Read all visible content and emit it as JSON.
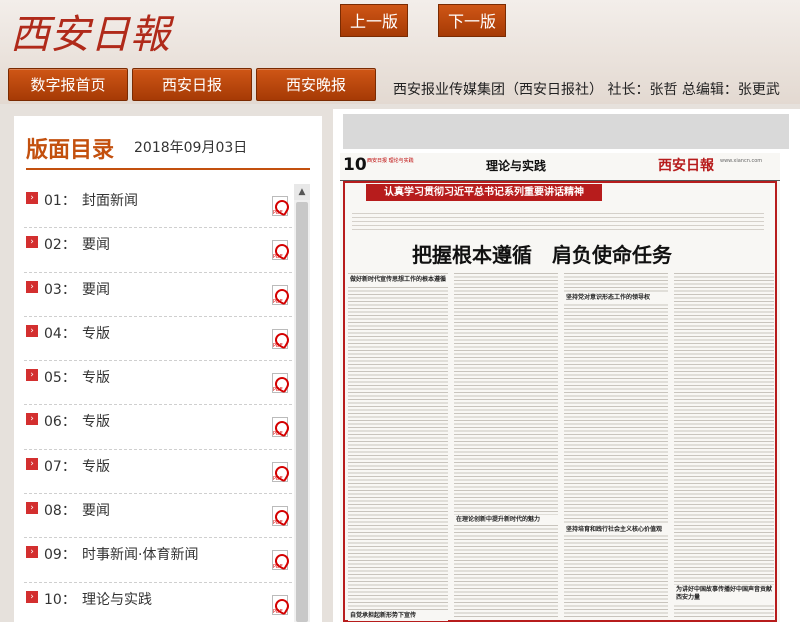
{
  "header": {
    "logo_text": "西安日報",
    "nav": [
      "数字报首页",
      "西安日报",
      "西安晚报"
    ],
    "org_info": "西安报业传媒集团（西安日报社） 社长：张哲 总编辑：张更武"
  },
  "left": {
    "title": "版面目录",
    "date": "2018年09月03日",
    "pages": [
      {
        "num": "01：",
        "name": "封面新闻"
      },
      {
        "num": "02：",
        "name": "要闻"
      },
      {
        "num": "03：",
        "name": "要闻"
      },
      {
        "num": "04：",
        "name": "专版"
      },
      {
        "num": "05：",
        "name": "专版"
      },
      {
        "num": "06：",
        "name": "专版"
      },
      {
        "num": "07：",
        "name": "专版"
      },
      {
        "num": "08：",
        "name": "要闻"
      },
      {
        "num": "09：",
        "name": "时事新闻·体育新闻"
      },
      {
        "num": "10：",
        "name": "理论与实践"
      }
    ]
  },
  "right": {
    "prev_label": "上一版",
    "next_label": "下一版",
    "newspaper": {
      "page_no": "10",
      "small_text": "西安日报 理论与实践",
      "section": "理论与实践",
      "logo": "西安日報",
      "url": "www.xiancn.com",
      "banner": "认真学习贯彻习近平总书记系列重要讲话精神",
      "headline": "把握根本遵循　肩负使命任务",
      "subheads": [
        "做好新时代宣传思想工作的根本遵循",
        "坚持党对意识形态工作的领导权",
        "在理论创新中提升新时代的魅力",
        "坚持培育和践行社会主义核心价值观",
        "为讲好中国故事传播好中国声音贡献西安力量",
        "自觉承担起新形势下宣传"
      ]
    }
  },
  "colors": {
    "accent": "#c3500e",
    "button": "#b84608",
    "paper_red": "#b71c1c"
  }
}
